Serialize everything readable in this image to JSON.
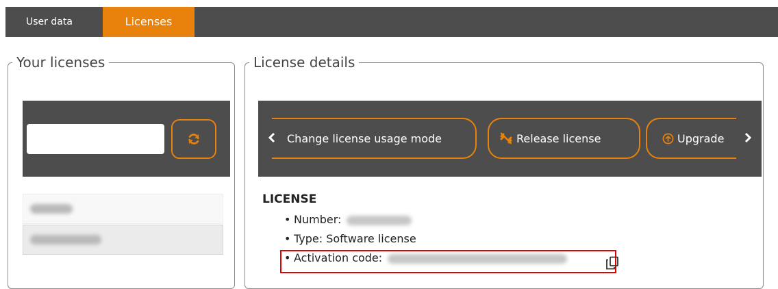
{
  "tabs": [
    {
      "label": "User data",
      "active": false
    },
    {
      "label": "Licenses",
      "active": true
    }
  ],
  "left_panel": {
    "legend": "Your licenses",
    "search": {
      "value": "",
      "placeholder": ""
    },
    "refresh_icon": "refresh-icon",
    "licenses": [
      {
        "label": "(blurred)",
        "selected": false
      },
      {
        "label": "(blurred)",
        "selected": true
      }
    ]
  },
  "right_panel": {
    "legend": "License details",
    "toolbar": {
      "prev_icon": "chevron-left-icon",
      "next_icon": "chevron-right-icon",
      "change_mode_label": "Change license usage mode",
      "release_label": "Release license",
      "release_icon": "unlink-icon",
      "upgrade_label": "Upgrade",
      "upgrade_icon": "arrow-up-circle-icon"
    },
    "section_title": "LICENSE",
    "number_label": "Number:",
    "type_label": "Type: Software license",
    "activation_label": "Activation code:",
    "copy_icon": "copy-icon"
  },
  "colors": {
    "accent": "#e8820c",
    "bar": "#4d4d4d",
    "highlight": "#e30000"
  }
}
